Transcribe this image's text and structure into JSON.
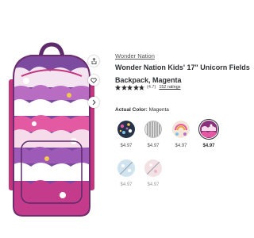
{
  "product": {
    "brand": "Wonder Nation",
    "title_line1": "Wonder Nation Kids' 17\" Unicorn Fields",
    "title_line2": "Backpack, Magenta",
    "rating": "(4.7)",
    "rating_stars": 4.7,
    "reviews": "152 ratings"
  },
  "actual_color": {
    "label": "Actual Color:",
    "value": "Magenta"
  },
  "swatches": [
    {
      "name": "floral-navy",
      "price": "$4.97",
      "available": true
    },
    {
      "name": "gray-stripe",
      "price": "$4.97",
      "available": true
    },
    {
      "name": "cream-rainbow",
      "price": "$4.97",
      "available": true
    },
    {
      "name": "magenta",
      "price": "$4.97",
      "available": true,
      "selected": true
    },
    {
      "name": "light-blue",
      "price": "$4.97",
      "available": false
    },
    {
      "name": "blush-pink",
      "price": "$4.97",
      "available": false
    }
  ],
  "icons": {
    "share": "share-icon",
    "favorite": "heart-icon",
    "next": "chevron-right-icon"
  },
  "colors": {
    "star": "#2e2f32",
    "selected_ring": "#2e2f32",
    "magenta": "#8b2f7a"
  }
}
